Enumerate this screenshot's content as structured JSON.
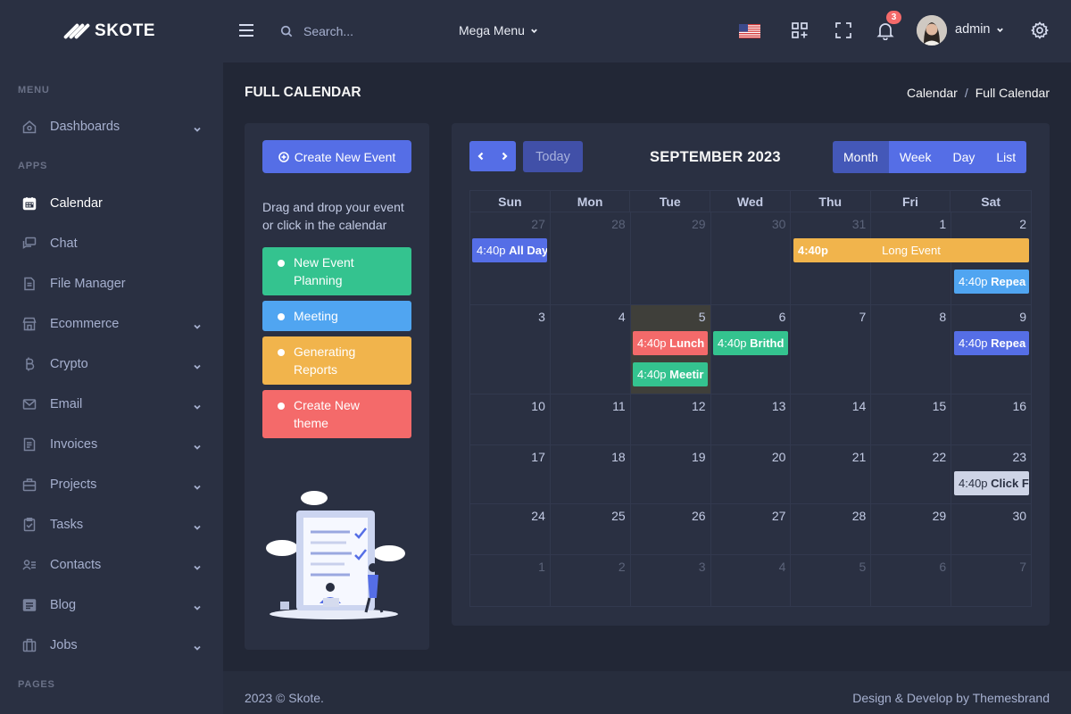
{
  "brand": {
    "name": "SKOTE"
  },
  "sidebar": {
    "sections": {
      "menu": "MENU",
      "apps": "APPS",
      "pages": "PAGES"
    },
    "items": [
      {
        "label": "Dashboards",
        "icon": "home-icon",
        "chevron": true
      },
      {
        "label": "Calendar",
        "icon": "calendar-icon",
        "chevron": false,
        "active": true
      },
      {
        "label": "Chat",
        "icon": "chat-icon",
        "chevron": false
      },
      {
        "label": "File Manager",
        "icon": "file-icon",
        "chevron": false
      },
      {
        "label": "Ecommerce",
        "icon": "store-icon",
        "chevron": true
      },
      {
        "label": "Crypto",
        "icon": "bitcoin-icon",
        "chevron": true
      },
      {
        "label": "Email",
        "icon": "envelope-icon",
        "chevron": true
      },
      {
        "label": "Invoices",
        "icon": "receipt-icon",
        "chevron": true
      },
      {
        "label": "Projects",
        "icon": "briefcase-icon",
        "chevron": true
      },
      {
        "label": "Tasks",
        "icon": "task-icon",
        "chevron": true
      },
      {
        "label": "Contacts",
        "icon": "contacts-icon",
        "chevron": true
      },
      {
        "label": "Blog",
        "icon": "blog-icon",
        "chevron": true
      },
      {
        "label": "Jobs",
        "icon": "jobs-icon",
        "chevron": true
      }
    ]
  },
  "topbar": {
    "search_placeholder": "Search...",
    "mega_menu": "Mega Menu",
    "notification_count": "3",
    "user": "admin"
  },
  "page": {
    "title": "FULL CALENDAR",
    "breadcrumb": [
      "Calendar",
      "Full Calendar"
    ],
    "breadcrumb_sep": "/"
  },
  "left_panel": {
    "create_button": "Create New Event",
    "hint": "Drag and drop your event or click in the calendar",
    "events": [
      {
        "label": "New Event Planning",
        "color": "#34c38f"
      },
      {
        "label": "Meeting",
        "color": "#50a5f1"
      },
      {
        "label": "Generating Reports",
        "color": "#f1b44c"
      },
      {
        "label": "Create New theme",
        "color": "#f46a6a"
      }
    ]
  },
  "calendar": {
    "today_label": "Today",
    "title": "SEPTEMBER 2023",
    "views": [
      "Month",
      "Week",
      "Day",
      "List"
    ],
    "active_view": "Month",
    "days_of_week": [
      "Sun",
      "Mon",
      "Tue",
      "Wed",
      "Thu",
      "Fri",
      "Sat"
    ],
    "weeks": [
      [
        "27",
        "28",
        "29",
        "30",
        "31",
        "1",
        "2"
      ],
      [
        "3",
        "4",
        "5",
        "6",
        "7",
        "8",
        "9"
      ],
      [
        "10",
        "11",
        "12",
        "13",
        "14",
        "15",
        "16"
      ],
      [
        "17",
        "18",
        "19",
        "20",
        "21",
        "22",
        "23"
      ],
      [
        "24",
        "25",
        "26",
        "27",
        "28",
        "29",
        "30"
      ],
      [
        "1",
        "2",
        "3",
        "4",
        "5",
        "6",
        "7"
      ]
    ],
    "events": [
      {
        "time": "4:40p",
        "title": "All Day",
        "week": 0,
        "day": 0,
        "span": 1,
        "slot": 0,
        "color": "#556ee6"
      },
      {
        "time": "4:40p",
        "title": "Long Event",
        "week": 0,
        "day": 4,
        "span": 3,
        "slot": 0,
        "color": "#f1b44c"
      },
      {
        "time": "4:40p",
        "title": "Repea",
        "week": 0,
        "day": 6,
        "span": 1,
        "slot": 1,
        "color": "#50a5f1"
      },
      {
        "time": "4:40p",
        "title": "Lunch",
        "week": 1,
        "day": 2,
        "span": 1,
        "slot": 0,
        "color": "#f46a6a"
      },
      {
        "time": "4:40p",
        "title": "Meetir",
        "week": 1,
        "day": 2,
        "span": 1,
        "slot": 1,
        "color": "#34c38f"
      },
      {
        "time": "4:40p",
        "title": "Brithd",
        "week": 1,
        "day": 3,
        "span": 1,
        "slot": 0,
        "color": "#34c38f"
      },
      {
        "time": "4:40p",
        "title": "Repea",
        "week": 1,
        "day": 6,
        "span": 1,
        "slot": 0,
        "color": "#556ee6"
      },
      {
        "time": "4:40p",
        "title": "Click F",
        "week": 3,
        "day": 6,
        "span": 1,
        "slot": 0,
        "color": "#ced4e6",
        "text_color": "#2a3042"
      }
    ]
  },
  "footer": {
    "left": "2023 © Skote.",
    "right": "Design & Develop by Themesbrand"
  }
}
